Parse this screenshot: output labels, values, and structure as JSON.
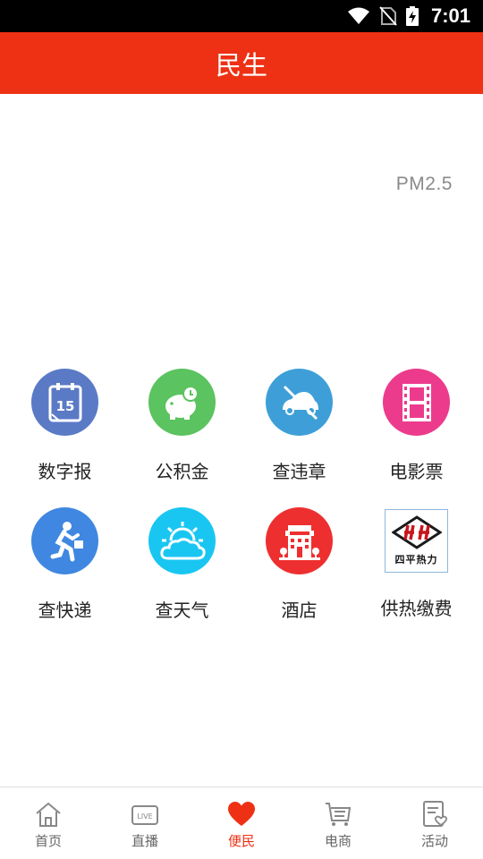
{
  "status_bar": {
    "time": "7:01"
  },
  "header": {
    "title": "民生"
  },
  "weather": {
    "pm_label": "PM2.5"
  },
  "services": [
    {
      "label": "数字报",
      "icon": "calendar-icon",
      "color": "#5b7ac6"
    },
    {
      "label": "公积金",
      "icon": "piggy-bank-icon",
      "color": "#5bc35f"
    },
    {
      "label": "查违章",
      "icon": "car-icon",
      "color": "#3e9fd8"
    },
    {
      "label": "电影票",
      "icon": "film-icon",
      "color": "#ec3b8c"
    },
    {
      "label": "查快递",
      "icon": "courier-icon",
      "color": "#3f87e0"
    },
    {
      "label": "查天气",
      "icon": "weather-icon",
      "color": "#19c6f2"
    },
    {
      "label": "酒店",
      "icon": "hotel-icon",
      "color": "#ee2f2f"
    },
    {
      "label": "供热缴费",
      "icon": "siping-heating-logo",
      "logo_text": "四平热力"
    }
  ],
  "tabbar": {
    "items": [
      {
        "label": "首页",
        "icon": "home-icon"
      },
      {
        "label": "直播",
        "icon": "live-icon"
      },
      {
        "label": "便民",
        "icon": "heart-icon",
        "active": true
      },
      {
        "label": "电商",
        "icon": "cart-icon"
      },
      {
        "label": "活动",
        "icon": "activity-icon"
      }
    ],
    "active_color": "#ee3114"
  }
}
